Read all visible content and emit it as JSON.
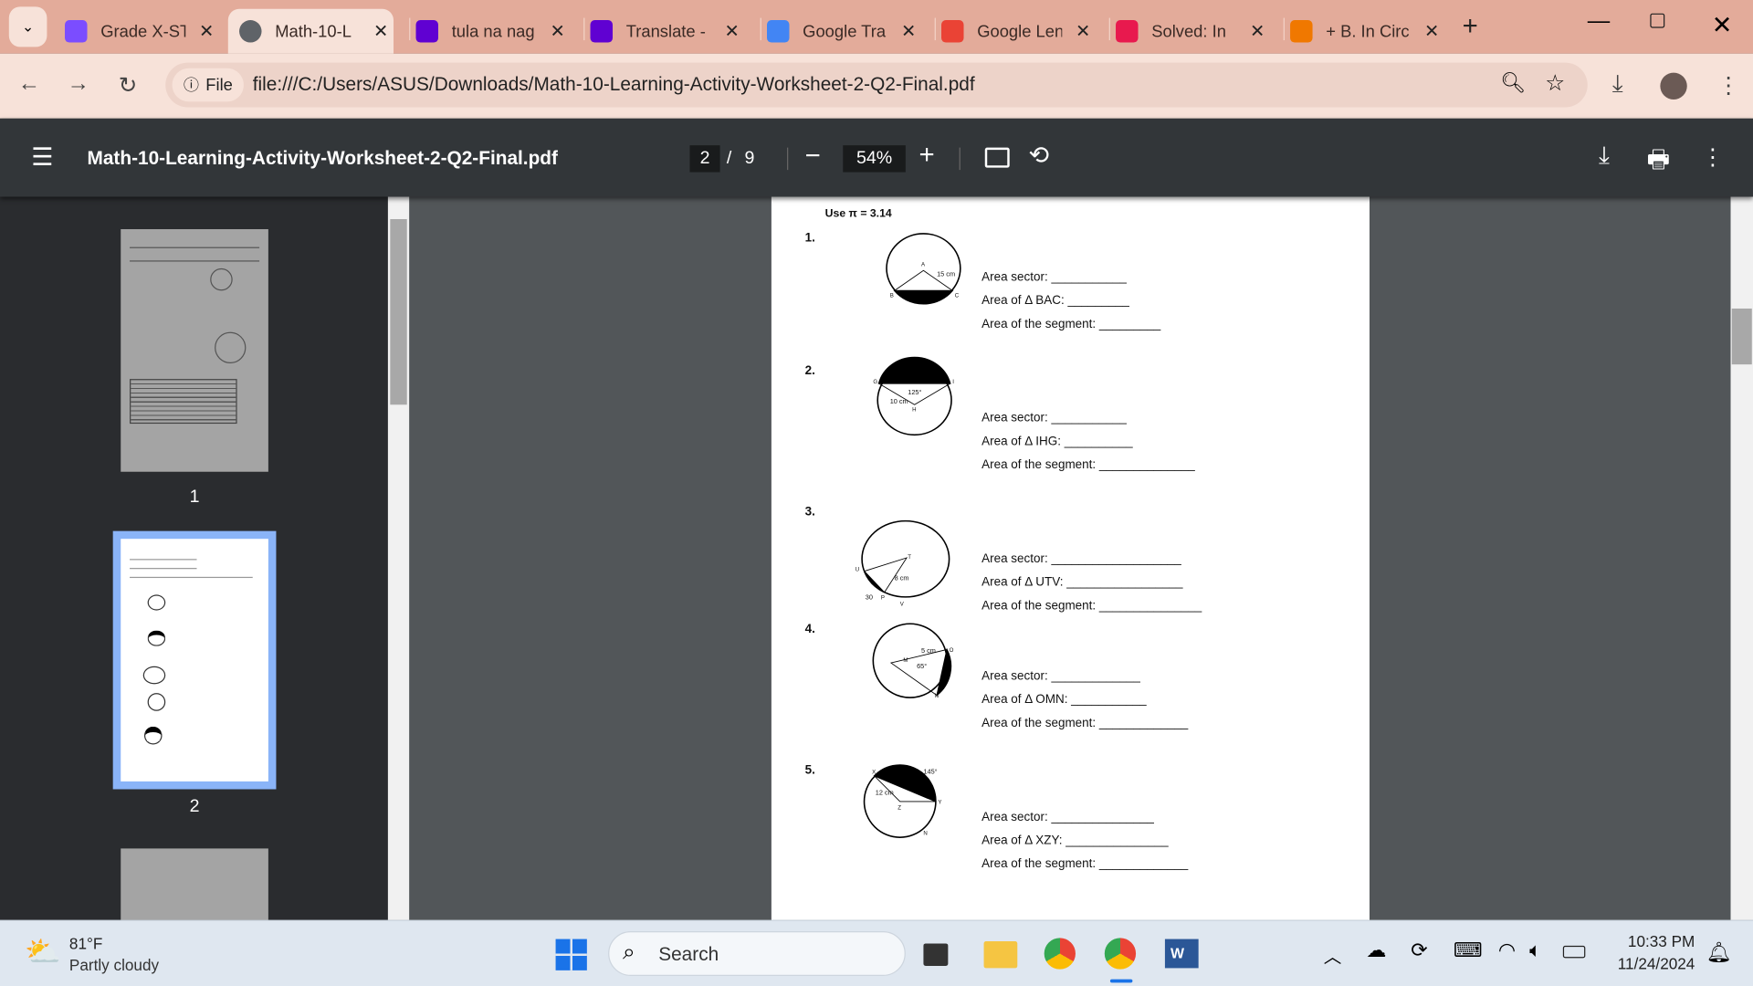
{
  "browser": {
    "tabs": [
      {
        "title": "Grade X-ST",
        "icon": "messenger-icon",
        "color": "#7b4dff",
        "active": false
      },
      {
        "title": "Math-10-L",
        "icon": "globe-icon",
        "color": "#5f6368",
        "active": true
      },
      {
        "title": "tula na nag",
        "icon": "yahoo-icon",
        "color": "#6001d2",
        "active": false
      },
      {
        "title": "Translate -",
        "icon": "yahoo-icon",
        "color": "#6001d2",
        "active": false
      },
      {
        "title": "Google Tra",
        "icon": "google-translate-icon",
        "color": "#4285f4",
        "active": false
      },
      {
        "title": "Google Len",
        "icon": "google-lens-icon",
        "color": "#ea4335",
        "active": false
      },
      {
        "title": "Solved: In",
        "icon": "chegg-icon",
        "color": "#e8194e",
        "active": false
      },
      {
        "title": "+ B. In Circ",
        "icon": "c-icon",
        "color": "#f07800",
        "active": false
      }
    ],
    "new_tab": "+",
    "site_chip": "File",
    "url": "file:///C:/Users/ASUS/Downloads/Math-10-Learning-Activity-Worksheet-2-Q2-Final.pdf"
  },
  "pdf": {
    "title": "Math-10-Learning-Activity-Worksheet-2-Q2-Final.pdf",
    "page_current": "2",
    "page_sep": "/",
    "page_total": "9",
    "zoom": "54%",
    "thumbnails": [
      "1",
      "2"
    ],
    "selected_thumbnail": 2
  },
  "worksheet": {
    "pi_note": "Use π = 3.14",
    "problems": [
      {
        "num": "1.",
        "labels": {
          "A": "A",
          "B": "B",
          "C": "C",
          "r": "15 cm"
        },
        "lines": [
          "Area sector: ___________",
          "Area of Δ BAC: _________",
          "Area of the segment: _________"
        ]
      },
      {
        "num": "2.",
        "labels": {
          "G": "G",
          "I": "I",
          "H": "H",
          "r": "10 cm",
          "angle": "125°"
        },
        "lines": [
          "Area sector: ___________",
          "Area of Δ IHG: __________",
          "Area of the segment: ______________"
        ]
      },
      {
        "num": "3.",
        "labels": {
          "T": "T",
          "U": "U",
          "P": "P",
          "V": "V",
          "r": "8 cm",
          "angle": "30"
        },
        "lines": [
          "Area sector: ___________________",
          "Area of Δ UTV: _________________",
          "Area of the segment: _______________"
        ]
      },
      {
        "num": "4.",
        "labels": {
          "M": "M",
          "O": "O",
          "N": "N",
          "r": "5 cm",
          "angle": "65°"
        },
        "lines": [
          "Area sector: _____________",
          "Area of Δ OMN: ___________",
          "Area of the segment: _____________"
        ]
      },
      {
        "num": "5.",
        "labels": {
          "X": "X",
          "Y": "Y",
          "Z": "Z",
          "N": "N",
          "r": "12 cm",
          "angle": "145°"
        },
        "lines": [
          "Area sector: _______________",
          "Area of Δ XZY: _______________",
          "Area of the segment: _____________"
        ]
      }
    ]
  },
  "taskbar": {
    "weather_temp": "81°F",
    "weather_desc": "Partly cloudy",
    "search_placeholder": "Search",
    "time": "10:33 PM",
    "date": "11/24/2024"
  }
}
